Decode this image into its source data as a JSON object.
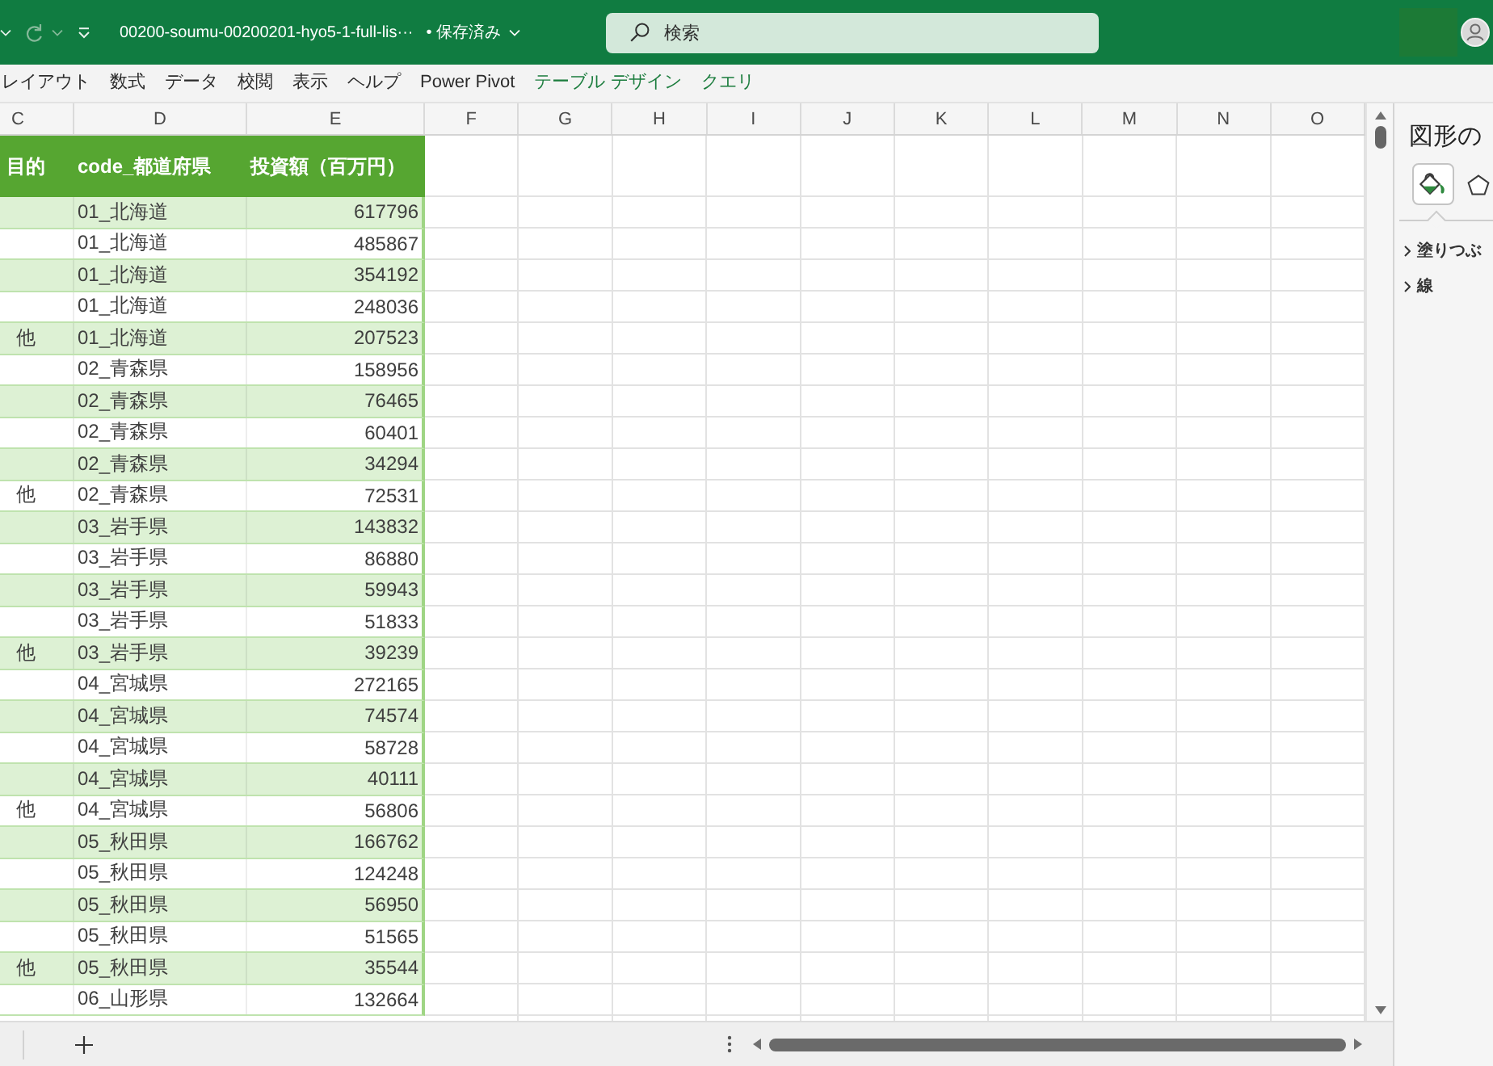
{
  "title_bar": {
    "file_name": "00200-soumu-00200201-hyo5-1-full-lis···",
    "save_status": "• 保存済み",
    "search": {
      "placeholder": "検索"
    }
  },
  "ribbon_tabs": [
    {
      "label": "レイアウト",
      "kind": "standard",
      "selected": false
    },
    {
      "label": "数式",
      "kind": "standard",
      "selected": false
    },
    {
      "label": "データ",
      "kind": "standard",
      "selected": false
    },
    {
      "label": "校閲",
      "kind": "standard",
      "selected": false
    },
    {
      "label": "表示",
      "kind": "standard",
      "selected": false
    },
    {
      "label": "ヘルプ",
      "kind": "standard",
      "selected": false
    },
    {
      "label": "Power Pivot",
      "kind": "standard",
      "selected": false
    },
    {
      "label": "テーブル デザイン",
      "kind": "contextual",
      "selected": false
    },
    {
      "label": "クエリ",
      "kind": "contextual",
      "selected": false
    }
  ],
  "sheet": {
    "columns": [
      "C",
      "D",
      "E",
      "F",
      "G",
      "H",
      "I",
      "J",
      "K",
      "L",
      "M",
      "N",
      "O"
    ],
    "table": {
      "headers": [
        "目的",
        "code_都道府県",
        "投資額（百万円）"
      ],
      "rows": [
        {
          "code_prefecture": "01_北海道",
          "amount": "617796"
        },
        {
          "code_prefecture": "01_北海道",
          "amount": "485867"
        },
        {
          "code_prefecture": "01_北海道",
          "amount": "354192"
        },
        {
          "code_prefecture": "01_北海道",
          "amount": "248036"
        },
        {
          "column_c": "他",
          "code_prefecture": "01_北海道",
          "amount": "207523"
        },
        {
          "code_prefecture": "02_青森県",
          "amount": "158956"
        },
        {
          "code_prefecture": "02_青森県",
          "amount": "76465"
        },
        {
          "code_prefecture": "02_青森県",
          "amount": "60401"
        },
        {
          "code_prefecture": "02_青森県",
          "amount": "34294"
        },
        {
          "column_c": "他",
          "code_prefecture": "02_青森県",
          "amount": "72531"
        },
        {
          "code_prefecture": "03_岩手県",
          "amount": "143832"
        },
        {
          "code_prefecture": "03_岩手県",
          "amount": "86880"
        },
        {
          "code_prefecture": "03_岩手県",
          "amount": "59943"
        },
        {
          "code_prefecture": "03_岩手県",
          "amount": "51833"
        },
        {
          "column_c": "他",
          "code_prefecture": "03_岩手県",
          "amount": "39239"
        },
        {
          "code_prefecture": "04_宮城県",
          "amount": "272165"
        },
        {
          "code_prefecture": "04_宮城県",
          "amount": "74574"
        },
        {
          "code_prefecture": "04_宮城県",
          "amount": "58728"
        },
        {
          "code_prefecture": "04_宮城県",
          "amount": "40111"
        },
        {
          "column_c": "他",
          "code_prefecture": "04_宮城県",
          "amount": "56806"
        },
        {
          "code_prefecture": "05_秋田県",
          "amount": "166762"
        },
        {
          "code_prefecture": "05_秋田県",
          "amount": "124248"
        },
        {
          "code_prefecture": "05_秋田県",
          "amount": "56950"
        },
        {
          "code_prefecture": "05_秋田県",
          "amount": "51565"
        },
        {
          "column_c": "他",
          "code_prefecture": "05_秋田県",
          "amount": "35544"
        },
        {
          "code_prefecture": "06_山形県",
          "amount": "132664"
        }
      ]
    }
  },
  "format_panel": {
    "title": "図形の",
    "tabs": [
      {
        "kind": "bucket",
        "selected": true
      },
      {
        "kind": "pentagon",
        "selected": false
      }
    ],
    "sections": [
      {
        "label": "塗りつぶ",
        "expanded": false
      },
      {
        "label": "線",
        "expanded": false
      }
    ]
  }
}
